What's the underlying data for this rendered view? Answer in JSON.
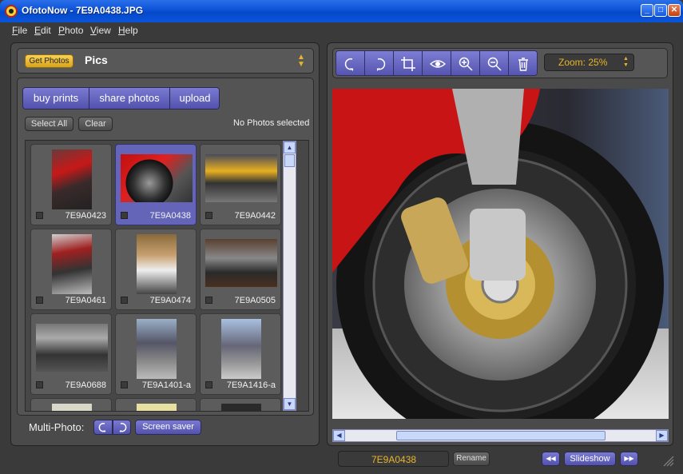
{
  "window": {
    "title": "OfotoNow - 7E9A0438.JPG",
    "min_glyph": "_",
    "max_glyph": "□",
    "close_glyph": "✕"
  },
  "menu": [
    "File",
    "Edit",
    "Photo",
    "View",
    "Help"
  ],
  "left_panel": {
    "get_photos_label": "Get Photos",
    "album_name": "Pics",
    "album_selector_icon": "up-down-arrows-icon",
    "actions": [
      "buy prints",
      "share photos",
      "upload"
    ],
    "select_all_label": "Select All",
    "clear_label": "Clear",
    "selection_status": "No Photos selected",
    "thumbnails": [
      {
        "name": "7E9A0423",
        "selected": false
      },
      {
        "name": "7E9A0438",
        "selected": true
      },
      {
        "name": "7E9A0442",
        "selected": false
      },
      {
        "name": "7E9A0461",
        "selected": false
      },
      {
        "name": "7E9A0474",
        "selected": false
      },
      {
        "name": "7E9A0505",
        "selected": false
      },
      {
        "name": "7E9A0688",
        "selected": false
      },
      {
        "name": "7E9A1401-a",
        "selected": false
      },
      {
        "name": "7E9A1416-a",
        "selected": false
      }
    ],
    "multi_photo_label": "Multi-Photo:",
    "screen_saver_label": "Screen saver"
  },
  "viewer": {
    "toolbar_icons": [
      "rotate-left-icon",
      "rotate-right-icon",
      "crop-icon",
      "red-eye-icon",
      "zoom-in-icon",
      "zoom-out-icon",
      "trash-icon"
    ],
    "zoom_label": "Zoom: 25%",
    "filename": "7E9A0438",
    "rename_label": "Rename",
    "slideshow_label": "Slideshow",
    "prev_glyph": "◀◀",
    "next_glyph": "▶▶"
  },
  "colors": {
    "accent_blue": "#5f5fc0",
    "accent_yellow": "#e8b52a",
    "panel": "#4a4a4a"
  }
}
